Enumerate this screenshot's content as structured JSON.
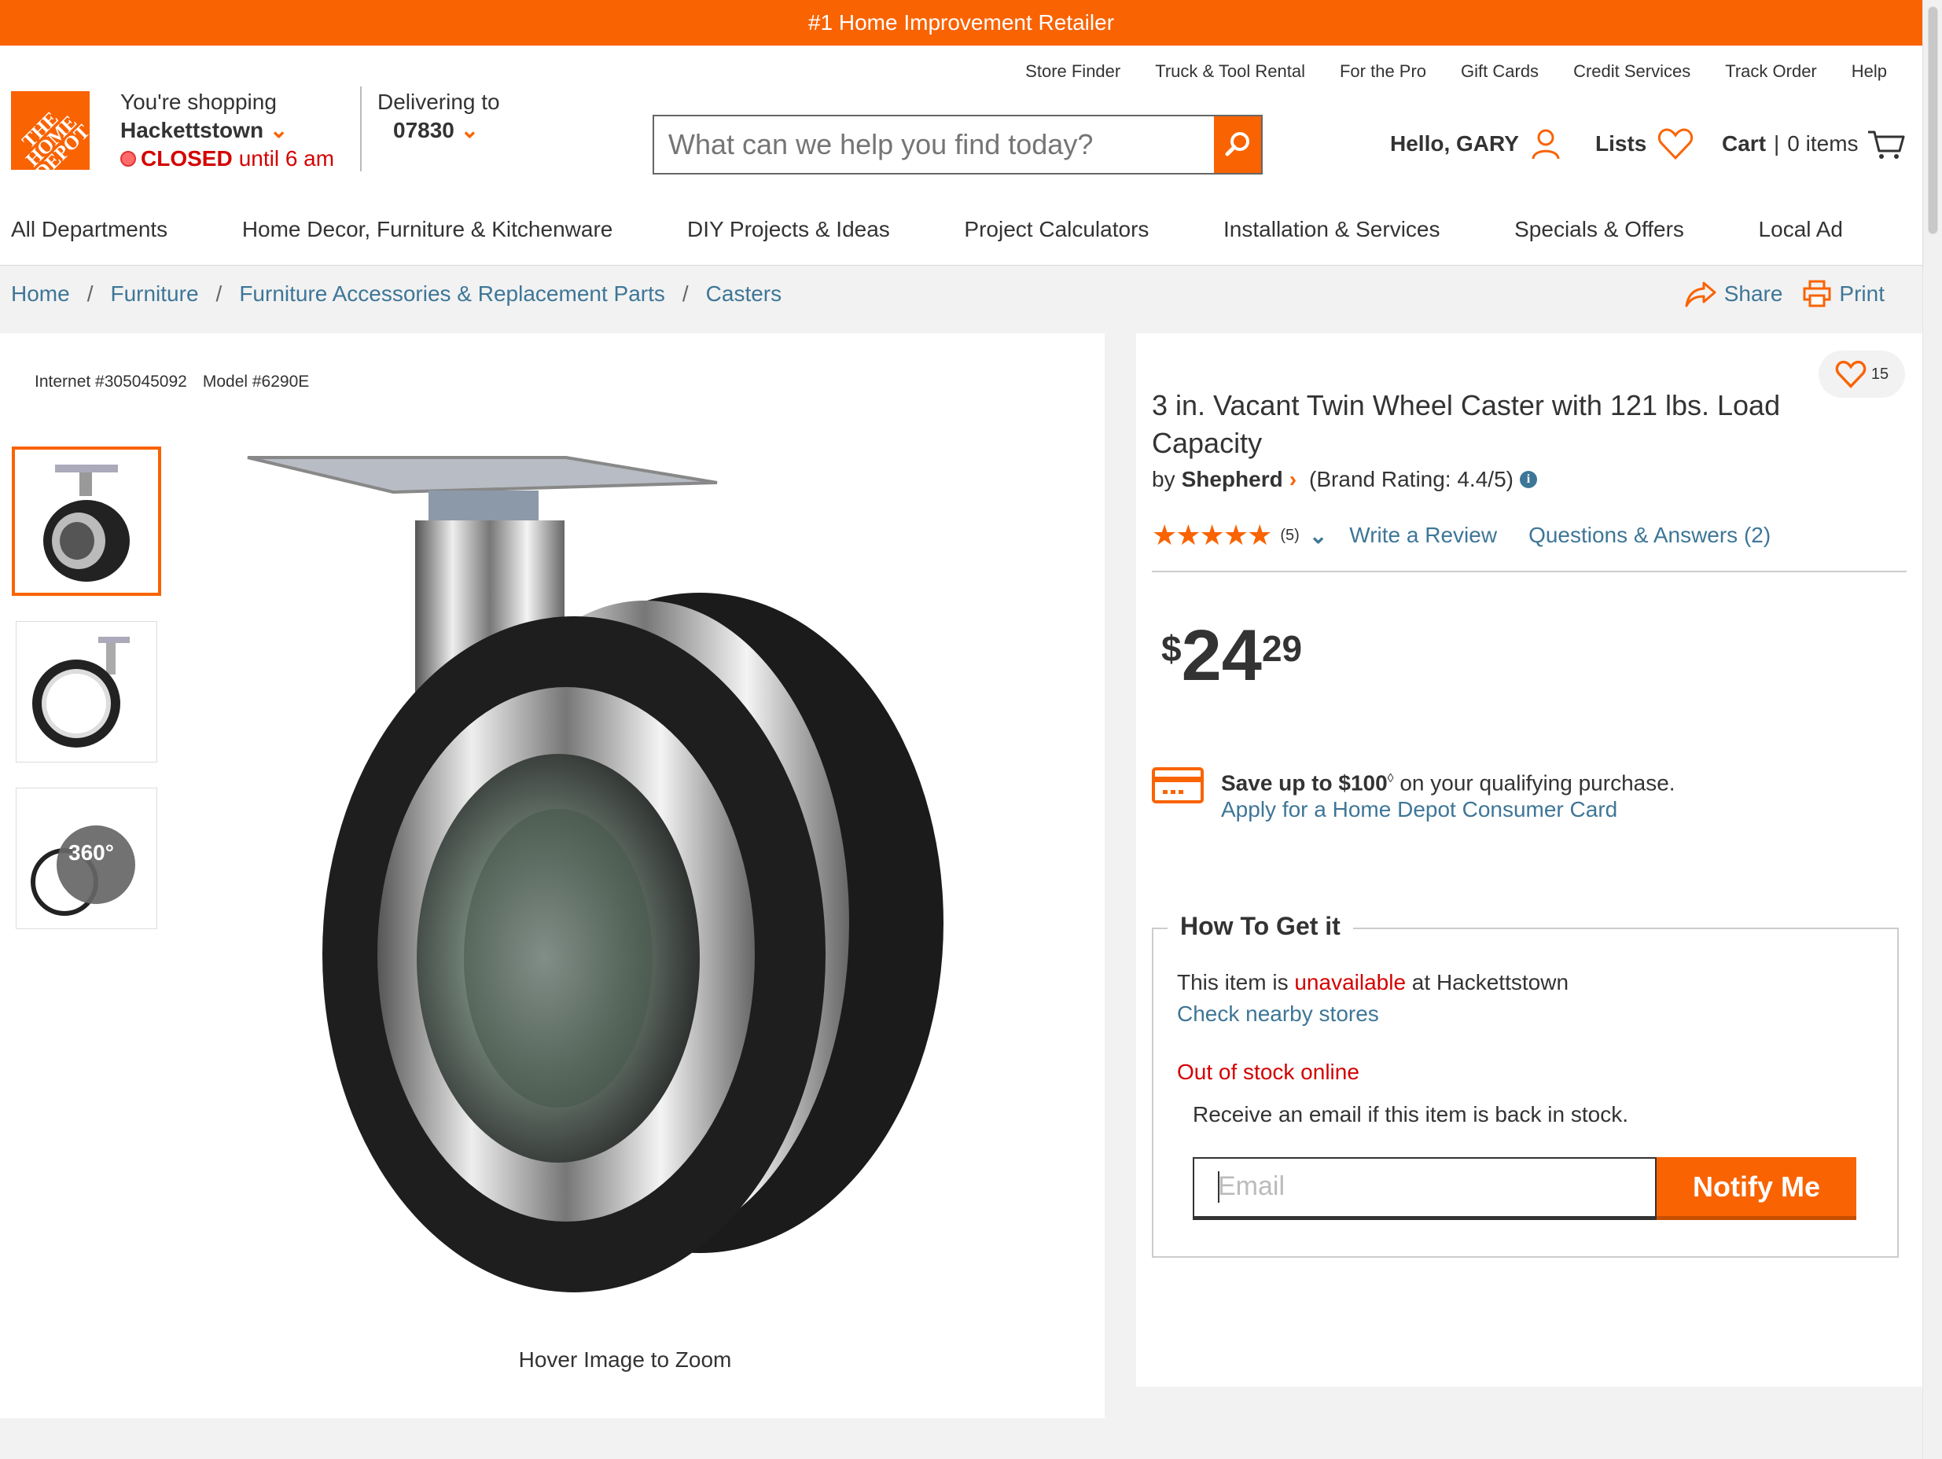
{
  "banner": {
    "text": "#1 Home Improvement Retailer"
  },
  "header": {
    "util_links": [
      "Store Finder",
      "Truck & Tool Rental",
      "For the Pro",
      "Gift Cards",
      "Credit Services",
      "Track Order",
      "Help"
    ],
    "logo_text": "THE HOME DEPOT",
    "shopping_label": "You're shopping",
    "store_name": "Hackettstown",
    "store_status": "CLOSED",
    "store_until": "until 6 am",
    "delivering_label": "Delivering to",
    "zip": "07830",
    "search_placeholder": "What can we help you find today?",
    "greeting": "Hello, GARY",
    "lists_label": "Lists",
    "cart_label": "Cart",
    "cart_items": "0 items"
  },
  "nav": [
    "All Departments",
    "Home Decor, Furniture & Kitchenware",
    "DIY Projects & Ideas",
    "Project Calculators",
    "Installation & Services",
    "Specials & Offers",
    "Local Ad"
  ],
  "breadcrumb": [
    "Home",
    "Furniture",
    "Furniture Accessories & Replacement Parts",
    "Casters"
  ],
  "actions": {
    "share": "Share",
    "print": "Print"
  },
  "product": {
    "internet_no": "Internet #305045092",
    "model_no": "Model #6290E",
    "title": "3 in. Vacant Twin Wheel Caster with 121 lbs. Load Capacity",
    "by": "by",
    "brand": "Shepherd",
    "brand_rating": "(Brand Rating: 4.4/5)",
    "rating_stars": 5,
    "review_count": "(5)",
    "write_review": "Write a Review",
    "qa": "Questions & Answers (2)",
    "favorites_count": "15",
    "price_currency": "$",
    "price_dollars": "24",
    "price_cents": "29",
    "zoom_hint": "Hover Image to Zoom",
    "thumb_360_label": "360°"
  },
  "promo": {
    "save_line": "Save up to $100",
    "save_mark": "◊",
    "save_suffix": " on your qualifying purchase.",
    "apply": "Apply for a Home Depot Consumer Card"
  },
  "fulfillment": {
    "title": "How To Get it",
    "avail_prefix": "This item is ",
    "avail_status": "unavailable",
    "avail_suffix": " at Hackettstown",
    "check_stores": "Check nearby stores",
    "oos": "Out of stock online",
    "receive": "Receive an email if this item is back in stock.",
    "email_placeholder": "Email",
    "notify": "Notify Me"
  },
  "colors": {
    "accent": "#f96302",
    "link": "#3e7697",
    "alert": "#d40000"
  }
}
